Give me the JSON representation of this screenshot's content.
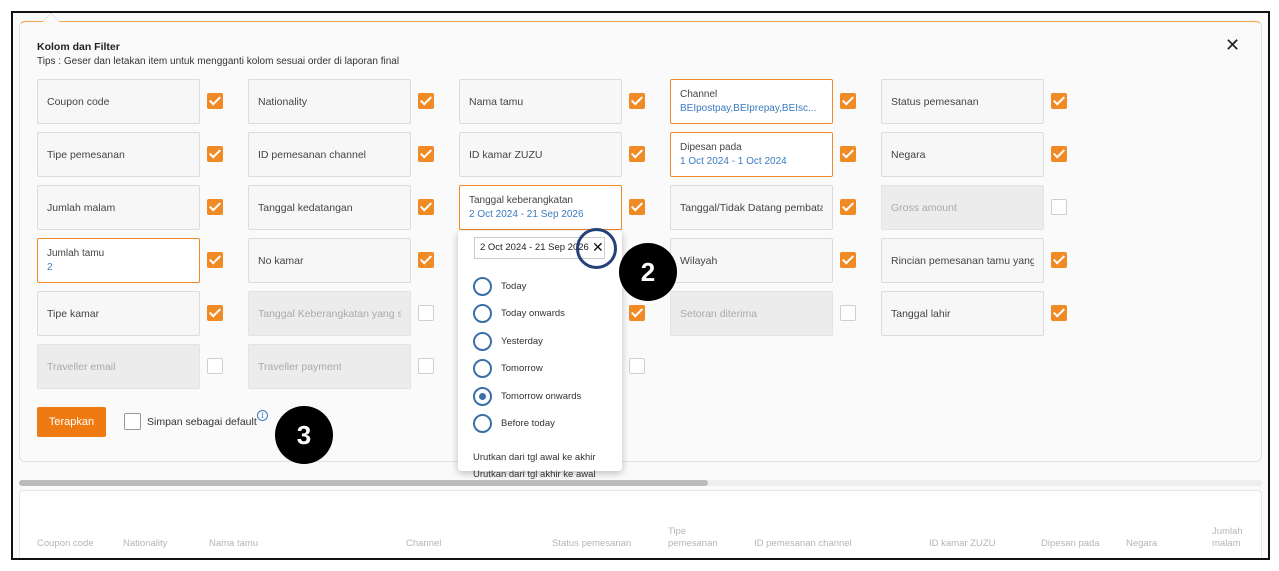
{
  "panel": {
    "title": "Kolom dan Filter",
    "tips": "Tips : Geser dan letakan item untuk mengganti kolom sesuai order di laporan final",
    "close_label": "✕"
  },
  "fields": [
    {
      "label": "Coupon code",
      "value": "",
      "checked": true,
      "state": "normal"
    },
    {
      "label": "Nationality",
      "value": "",
      "checked": true,
      "state": "normal"
    },
    {
      "label": "Nama tamu",
      "value": "",
      "checked": true,
      "state": "normal"
    },
    {
      "label": "Channel",
      "value": "BEIpostpay,BEIprepay,BEIsc...",
      "checked": true,
      "state": "active"
    },
    {
      "label": "Status pemesanan",
      "value": "",
      "checked": true,
      "state": "normal"
    },
    {
      "label": "Tipe pemesanan",
      "value": "",
      "checked": true,
      "state": "normal"
    },
    {
      "label": "ID pemesanan channel",
      "value": "",
      "checked": true,
      "state": "normal"
    },
    {
      "label": "ID kamar ZUZU",
      "value": "",
      "checked": true,
      "state": "normal"
    },
    {
      "label": "Dipesan pada",
      "value": "1 Oct 2024 - 1 Oct 2024",
      "checked": true,
      "state": "active"
    },
    {
      "label": "Negara",
      "value": "",
      "checked": true,
      "state": "normal"
    },
    {
      "label": "Jumlah malam",
      "value": "",
      "checked": true,
      "state": "normal"
    },
    {
      "label": "Tanggal kedatangan",
      "value": "",
      "checked": true,
      "state": "normal"
    },
    {
      "label": "Tanggal keberangkatan",
      "value": "2 Oct 2024 - 21 Sep 2026",
      "checked": true,
      "state": "active"
    },
    {
      "label": "Tanggal/Tidak Datang pembatalan",
      "value": "",
      "checked": true,
      "state": "normal"
    },
    {
      "label": "Gross amount",
      "value": "",
      "checked": false,
      "state": "disabled"
    },
    {
      "label": "Jumlah tamu",
      "value": "2",
      "checked": true,
      "state": "active"
    },
    {
      "label": "No kamar",
      "value": "",
      "checked": true,
      "state": "normal"
    },
    {
      "label": "Wilayah",
      "value": "",
      "checked": true,
      "state": "normal"
    },
    {
      "label": "Rincian pemesanan tamu yang hadir",
      "value": "",
      "checked": true,
      "state": "normal"
    },
    {
      "label": "Tipe kamar",
      "value": "",
      "checked": true,
      "state": "normal"
    },
    {
      "label": "Tanggal Keberangkatan yang sebenarnya",
      "value": "",
      "checked": false,
      "state": "disabled"
    },
    {
      "label": "Setoran diterima",
      "value": "",
      "checked": false,
      "state": "disabled"
    },
    {
      "label": "Tanggal lahir",
      "value": "",
      "checked": true,
      "state": "normal"
    },
    {
      "label": "Traveller email",
      "value": "",
      "checked": false,
      "state": "disabled"
    },
    {
      "label": "Traveller payment",
      "value": "",
      "checked": false,
      "state": "disabled"
    }
  ],
  "hidden_checkboxes": [
    {
      "checked": true
    },
    {
      "checked": false
    }
  ],
  "footer": {
    "apply_label": "Terapkan",
    "save_default_label": "Simpan sebagai default",
    "save_default_checked": false,
    "info_glyph": "i"
  },
  "dropdown": {
    "input_value": "2 Oct 2024 - 21 Sep 2026",
    "clear_label": "✕",
    "options": [
      {
        "label": "Today",
        "selected": false
      },
      {
        "label": "Today onwards",
        "selected": false
      },
      {
        "label": "Yesterday",
        "selected": false
      },
      {
        "label": "Tomorrow",
        "selected": false
      },
      {
        "label": "Tomorrow onwards",
        "selected": true
      },
      {
        "label": "Before today",
        "selected": false
      }
    ],
    "sort_asc": "Urutkan dari tgl awal ke akhir",
    "sort_desc": "Urutkan dari tgl akhir ke awal"
  },
  "markers": {
    "two": "2",
    "three": "3"
  },
  "table": {
    "headers": [
      "Coupon code",
      "Nationality",
      "Nama tamu",
      "Channel",
      "Status pemesanan",
      "Tipe\npemesanan",
      "ID pemesanan channel",
      "ID kamar ZUZU",
      "Dipesan pada",
      "Negara",
      "Jumlah\nmalam"
    ]
  },
  "colors": {
    "accent": "#f07a12",
    "checkbox_on": "#f08a24",
    "link_value": "#3a7bbf",
    "marker": "#000000",
    "highlight_ring": "#25417a"
  }
}
